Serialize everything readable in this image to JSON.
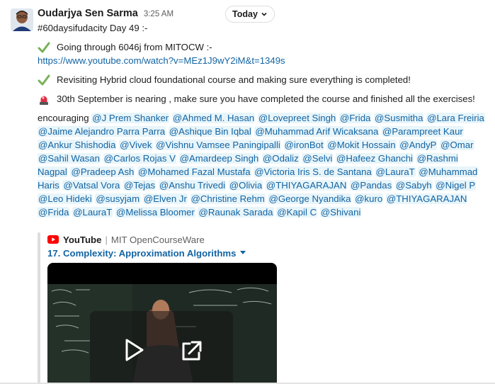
{
  "message": {
    "author": "Oudarjya Sen Sarma",
    "time": "3:25 AM",
    "date_pill": "Today",
    "lines": {
      "title": "#60daysifudacity Day 49 :-",
      "item1": "Going through 6046j from MITOCW  :-",
      "item1_link": "https://www.youtube.com/watch?v=MEz1J9wY2iM&t=1349s",
      "item2": "Revisiting Hybrid cloud foundational course and making sure everything is completed!",
      "item3": "30th September is nearing , make sure you have completed the course and finished all the exercises!"
    },
    "encouraging_label": "encouraging",
    "mentions": [
      "@J Prem Shanker",
      "@Ahmed M. Hasan",
      "@Lovepreet Singh",
      "@Frida",
      "@Susmitha",
      "@Lara Freiria",
      "@Jaime Alejandro Parra Parra",
      "@Ashique Bin Iqbal",
      "@Muhammad Arif Wicaksana",
      "@Parampreet Kaur",
      "@Ankur Shishodia",
      "@Vivek",
      "@Vishnu Vamsee Paningipalli",
      "@ironBot",
      "@Mokit Hossain",
      "@AndyP",
      "@Omar",
      "@Sahil Wasan",
      "@Carlos Rojas V",
      "@Amardeep Singh",
      "@Odaliz",
      "@Selvi",
      "@Hafeez Ghanchi",
      "@Rashmi Nagpal",
      "@Pradeep Ash",
      "@Mohamed Fazal Mustafa",
      "@Victoria Iris S. de Santana",
      "@LauraT",
      "@Muhammad Haris",
      "@Vatsal Vora",
      "@Tejas",
      "@Anshu Trivedi",
      "@Olivia",
      "@THIYAGARAJAN",
      "@Pandas",
      "@Sabyh",
      "@Nigel P",
      "@Leo Hideki",
      "@susyjam",
      "@Elven Jr",
      "@Christine Rehm",
      "@George Nyandika",
      "@kuro",
      "@THIYAGARAJAN",
      "@Frida",
      "@LauraT",
      "@Melissa Bloomer",
      "@Raunak Sarada",
      "@Kapil C",
      "@Shivani"
    ]
  },
  "unfurl": {
    "provider": "YouTube",
    "separator": "|",
    "channel": "MIT OpenCourseWare",
    "video_title": "17. Complexity: Approximation Algorithms"
  },
  "icons": {
    "check": "check-mark-icon",
    "siren": "police-light-icon",
    "chevron": "chevron-down-icon",
    "youtube": "youtube-logo-icon",
    "play": "play-icon",
    "open": "open-external-icon"
  },
  "colors": {
    "link": "#1264a3",
    "mention_bg": "#e8f5fa",
    "check_green": "#78b159",
    "youtube_red": "#ff0000"
  }
}
